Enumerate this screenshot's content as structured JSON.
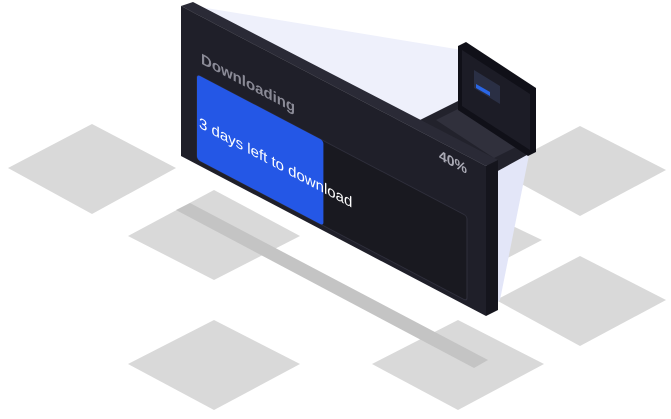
{
  "download": {
    "heading": "Downloading",
    "time_left": "3 days left to download",
    "percent_label": "40%",
    "progress": 0.4
  },
  "colors": {
    "accent": "#2457e6",
    "panel": "#1f1f29",
    "tile": "#d9d9d9"
  },
  "icons": {
    "device": "laptop-icon"
  }
}
